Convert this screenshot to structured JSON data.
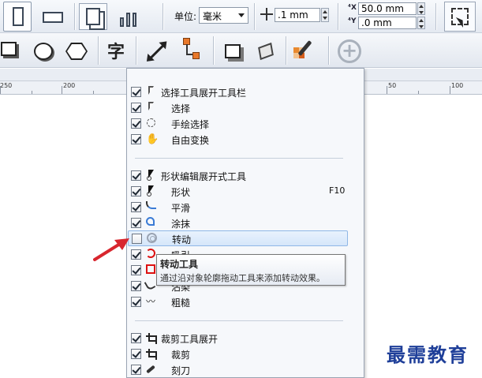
{
  "toolbar": {
    "unit_label": "单位:",
    "unit_value": "毫米",
    "nudge_value": ".1 mm",
    "dup_x_value": "50.0 mm",
    "dup_y_value": ".0 mm"
  },
  "tools": {
    "text_tool_glyph": "字"
  },
  "ruler": {
    "labels": [
      "250",
      "200",
      "50",
      "100"
    ]
  },
  "menu": {
    "groups": [
      {
        "label": "选择工具展开工具栏",
        "checked": true,
        "icon": "pointer-icon",
        "items": [
          {
            "label": "选择",
            "checked": true,
            "icon": "pointer-icon"
          },
          {
            "label": "手绘选择",
            "checked": true,
            "icon": "freehand-pick-icon"
          },
          {
            "label": "自由变换",
            "checked": true,
            "icon": "free-transform-icon"
          }
        ]
      },
      {
        "label": "形状编辑展开式工具",
        "checked": true,
        "icon": "shape-icon",
        "items": [
          {
            "label": "形状",
            "checked": true,
            "icon": "shape-icon",
            "shortcut": "F10"
          },
          {
            "label": "平滑",
            "checked": true,
            "icon": "smooth-icon"
          },
          {
            "label": "涂抹",
            "checked": true,
            "icon": "smear-icon"
          },
          {
            "label": "转动",
            "checked": false,
            "icon": "twirl-icon",
            "highlighted": true
          },
          {
            "label": "吸引",
            "checked": true,
            "icon": "attract-icon"
          },
          {
            "label": "排斥",
            "checked": true,
            "icon": "repel-icon"
          },
          {
            "label": "沾染",
            "checked": true,
            "icon": "smudge-icon"
          },
          {
            "label": "粗糙",
            "checked": true,
            "icon": "roughen-icon"
          }
        ]
      },
      {
        "label": "裁剪工具展开",
        "checked": true,
        "icon": "crop-icon",
        "items": [
          {
            "label": "裁剪",
            "checked": true,
            "icon": "crop-icon"
          },
          {
            "label": "刻刀",
            "checked": true,
            "icon": "knife-icon"
          }
        ]
      }
    ]
  },
  "tooltip": {
    "title": "转动工具",
    "description": "通过沿对象轮廓拖动工具来添加转动效果。"
  },
  "watermark": "最需教育",
  "colors": {
    "highlight_border": "#8fb7e6",
    "arrow": "#d8262e",
    "watermark": "#1f3f99"
  }
}
